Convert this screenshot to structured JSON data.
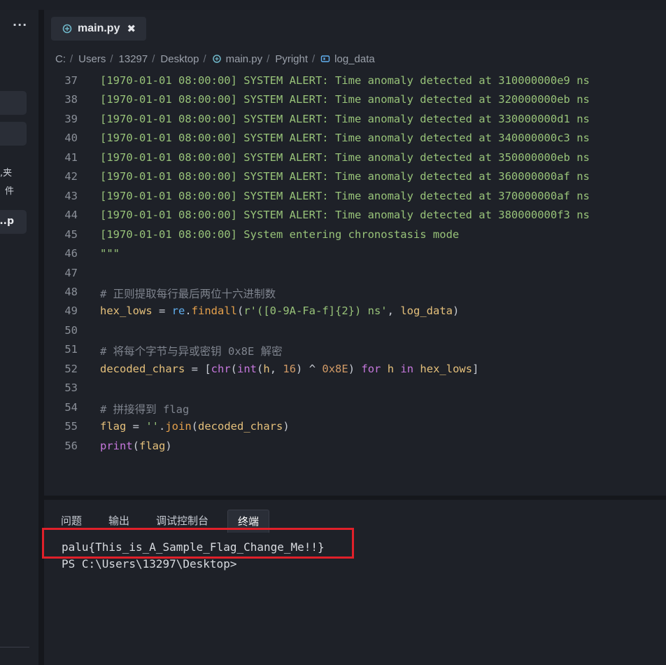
{
  "sidebar": {
    "menu_label": "···",
    "snippet_1": "夹,",
    "snippet_2": "件。",
    "snippet_3": "p..."
  },
  "editor": {
    "tab": {
      "label": "main.py",
      "close": "✖"
    },
    "breadcrumb": [
      "C:",
      "Users",
      "13297",
      "Desktop",
      "main.py",
      "Pyright",
      "log_data"
    ],
    "lines": [
      {
        "n": "37",
        "text": "[1970-01-01 08:00:00] SYSTEM ALERT: Time anomaly detected at 310000000e9 ns"
      },
      {
        "n": "38",
        "text": "[1970-01-01 08:00:00] SYSTEM ALERT: Time anomaly detected at 320000000eb ns"
      },
      {
        "n": "39",
        "text": "[1970-01-01 08:00:00] SYSTEM ALERT: Time anomaly detected at 330000000d1 ns"
      },
      {
        "n": "40",
        "text": "[1970-01-01 08:00:00] SYSTEM ALERT: Time anomaly detected at 340000000c3 ns"
      },
      {
        "n": "41",
        "text": "[1970-01-01 08:00:00] SYSTEM ALERT: Time anomaly detected at 350000000eb ns"
      },
      {
        "n": "42",
        "text": "[1970-01-01 08:00:00] SYSTEM ALERT: Time anomaly detected at 360000000af ns"
      },
      {
        "n": "43",
        "text": "[1970-01-01 08:00:00] SYSTEM ALERT: Time anomaly detected at 370000000af ns"
      },
      {
        "n": "44",
        "text": "[1970-01-01 08:00:00] SYSTEM ALERT: Time anomaly detected at 380000000f3 ns"
      },
      {
        "n": "45",
        "text": "[1970-01-01 08:00:00] System entering chronostasis mode"
      },
      {
        "n": "46",
        "text": "\"\"\""
      },
      {
        "n": "47",
        "text": ""
      },
      {
        "n": "48",
        "text": "# 正则提取每行最后两位十六进制数"
      },
      {
        "n": "49",
        "text": "hex_lows = re.findall(r'([0-9A-Fa-f]{2}) ns', log_data)"
      },
      {
        "n": "50",
        "text": ""
      },
      {
        "n": "51",
        "text": "# 将每个字节与异或密钥 0x8E 解密"
      },
      {
        "n": "52",
        "text": "decoded_chars = [chr(int(h, 16) ^ 0x8E) for h in hex_lows]"
      },
      {
        "n": "53",
        "text": ""
      },
      {
        "n": "54",
        "text": "# 拼接得到 flag"
      },
      {
        "n": "55",
        "text": "flag = ''.join(decoded_chars)"
      },
      {
        "n": "56",
        "text": "print(flag)"
      }
    ]
  },
  "panel": {
    "tabs": [
      "问题",
      "输出",
      "调试控制台",
      "终端"
    ],
    "active_tab": "终端",
    "terminal_output": "palu{This_is_A_Sample_Flag_Change_Me!!}",
    "terminal_prompt": "PS C:\\Users\\13297\\Desktop>"
  },
  "colors": {
    "highlight_box": "#e0202a",
    "string": "#98c379",
    "comment": "#7f848e"
  }
}
